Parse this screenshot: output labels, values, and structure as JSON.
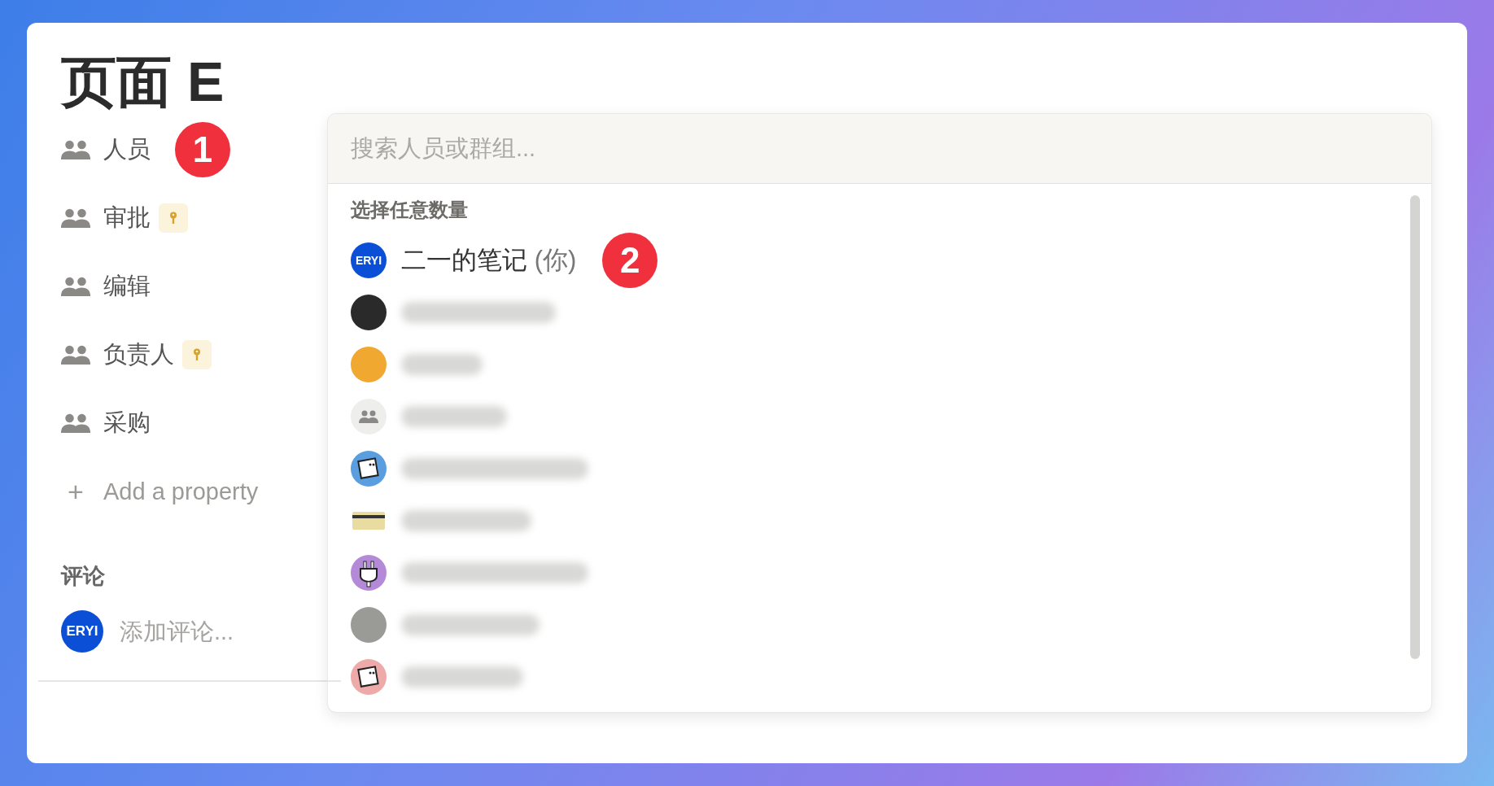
{
  "page": {
    "title": "页面 E"
  },
  "properties": [
    {
      "label": "人员",
      "locked": false,
      "callout": "1"
    },
    {
      "label": "审批",
      "locked": true
    },
    {
      "label": "编辑",
      "locked": false
    },
    {
      "label": "负责人",
      "locked": true
    },
    {
      "label": "采购",
      "locked": false
    }
  ],
  "add_property": {
    "icon": "+",
    "label": "Add a property"
  },
  "comments": {
    "heading": "评论",
    "avatar": "ERYI",
    "placeholder": "添加评论..."
  },
  "people_picker": {
    "search": {
      "placeholder": "搜索人员或群组..."
    },
    "section": "选择任意数量",
    "people": [
      {
        "kind": "initials",
        "avatar": "ERYI",
        "name": "二一的笔记",
        "suffix": "(你)",
        "callout": "2"
      },
      {
        "kind": "photo",
        "color": "#2a2a2a"
      },
      {
        "kind": "photo",
        "color": "#f0a830"
      },
      {
        "kind": "group",
        "color": "#eeeeec"
      },
      {
        "kind": "face",
        "color": "#5a9ee0"
      },
      {
        "kind": "card",
        "color": "#e8dca0"
      },
      {
        "kind": "plug",
        "color": "#b48ad8"
      },
      {
        "kind": "photo",
        "color": "#9a9a96"
      },
      {
        "kind": "face",
        "color": "#eeaaa8"
      }
    ]
  }
}
